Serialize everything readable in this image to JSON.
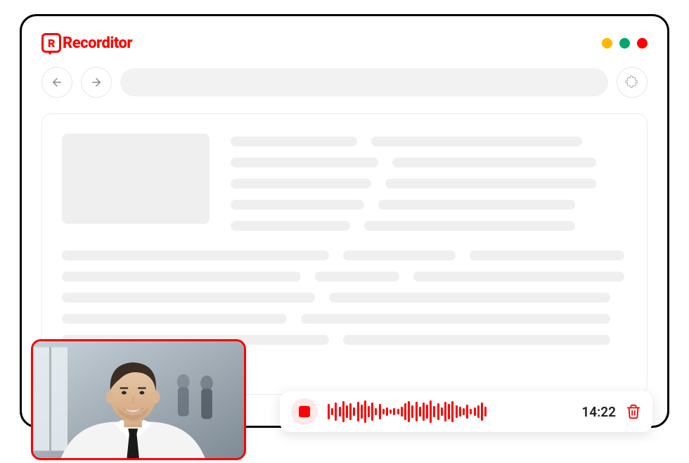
{
  "app": {
    "name": "Recorditor",
    "window_controls": [
      "minimize",
      "maximize",
      "close"
    ]
  },
  "nav": {
    "back_icon": "arrow-left",
    "forward_icon": "arrow-right",
    "extension_icon": "puzzle-piece",
    "address": ""
  },
  "recording": {
    "stop_icon": "stop",
    "elapsed_time": "14:22",
    "delete_icon": "trash",
    "waveform_heights": [
      22,
      10,
      26,
      14,
      30,
      18,
      24,
      12,
      28,
      20,
      32,
      16,
      26,
      10,
      22,
      8,
      12,
      6,
      10,
      8,
      14,
      24,
      30,
      18,
      28,
      14,
      26,
      20,
      32,
      16,
      24,
      12,
      28,
      22,
      30,
      18,
      14,
      10,
      20,
      8,
      12,
      18,
      26,
      14
    ]
  },
  "webcam": {
    "overlay_label": "webcam-preview"
  },
  "colors": {
    "accent": "#ff0000",
    "placeholder": "#efefef",
    "window_yellow": "#ffb800",
    "window_green": "#00a86b",
    "window_red": "#ff0000"
  }
}
